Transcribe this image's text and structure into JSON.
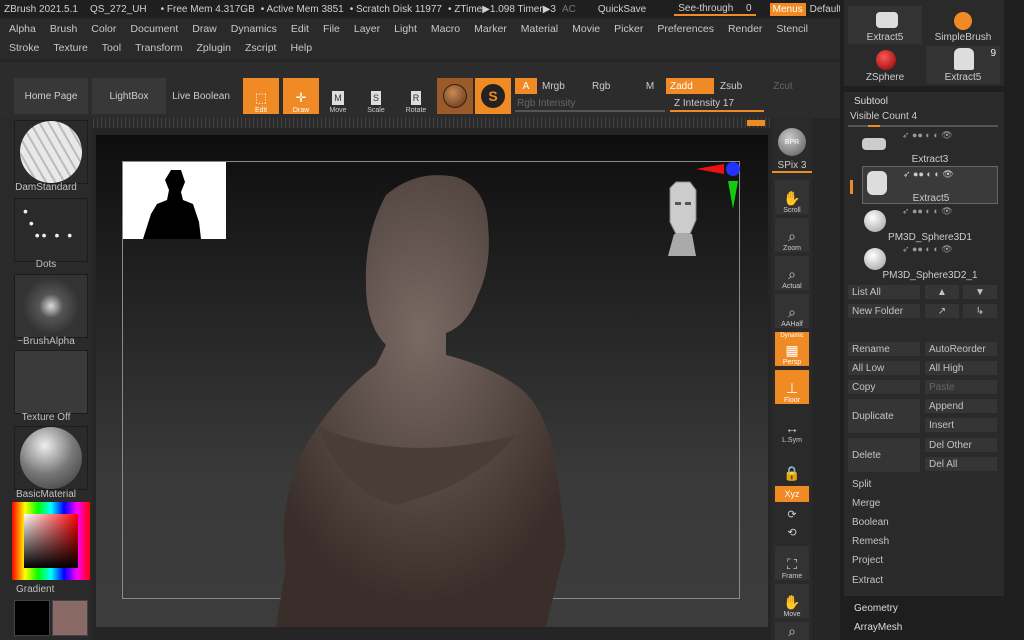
{
  "titlebar": {
    "app": "ZBrush 2021.5.1",
    "file": "QS_272_UH",
    "free_mem": "• Free Mem 4.317GB",
    "active_mem": "• Active Mem 3851",
    "scratch": "• Scratch Disk 11977",
    "ztime": "• ZTime▶1.098 Timer▶3",
    "ac": "AC",
    "quicksave": "QuickSave",
    "seethrough": "See-through",
    "seethrough_val": "0",
    "menus": "Menus",
    "zscript": "DefaultZScript"
  },
  "menu_row1": [
    "Alpha",
    "Brush",
    "Color",
    "Document",
    "Draw",
    "Dynamics",
    "Edit",
    "File",
    "Layer",
    "Light",
    "Macro",
    "Marker",
    "Material",
    "Movie",
    "Picker",
    "Preferences",
    "Render",
    "Stencil"
  ],
  "menu_row2": [
    "Stroke",
    "Texture",
    "Tool",
    "Transform",
    "Zplugin",
    "Zscript",
    "Help"
  ],
  "shelf": {
    "home": "Home Page",
    "lightbox": "LightBox",
    "liveboolean": "Live Boolean",
    "edit": "Edit",
    "draw": "Draw",
    "move": "Move",
    "scale": "Scale",
    "rotate": "Rotate",
    "a": "A",
    "mrgb": "Mrgb",
    "rgb": "Rgb",
    "m": "M",
    "zadd": "Zadd",
    "zsub": "Zsub",
    "zcut": "Zcut",
    "rgb_intensity": "Rgb Intensity",
    "z_intensity": "Z Intensity",
    "z_intensity_val": "17"
  },
  "left": {
    "brush": "DamStandard",
    "stroke": "Dots",
    "alpha": "~BrushAlpha",
    "texture": "Texture Off",
    "material": "BasicMaterial",
    "gradient": "Gradient"
  },
  "rightbar": {
    "bpr": "BPR",
    "spix": "SPix",
    "spix_val": "3",
    "scroll": "Scroll",
    "zoom": "Zoom",
    "actual": "Actual",
    "aahalf": "AAHalf",
    "dynamic": "Dynamic",
    "persp": "Persp",
    "floor": "Floor",
    "lsym": "L.Sym",
    "xyz": "Xyz",
    "frame": "Frame",
    "move": "Move"
  },
  "tools": {
    "extract5a": "Extract5",
    "simplebrush": "SimpleBrush",
    "zsphere": "ZSphere",
    "extract5b": "Extract5",
    "count": "9"
  },
  "subtool": {
    "title": "Subtool",
    "visible_count": "Visible Count",
    "visible_count_val": "4",
    "items": [
      "Extract3",
      "Extract5",
      "PM3D_Sphere3D1",
      "PM3D_Sphere3D2_1"
    ],
    "list_all": "List All",
    "new_folder": "New Folder",
    "rename": "Rename",
    "autoreorder": "AutoReorder",
    "all_low": "All Low",
    "all_high": "All High",
    "copy": "Copy",
    "paste": "Paste",
    "duplicate": "Duplicate",
    "append": "Append",
    "insert": "Insert",
    "delete": "Delete",
    "del_other": "Del Other",
    "del_all": "Del All",
    "split": "Split",
    "merge": "Merge",
    "boolean": "Boolean",
    "remesh": "Remesh",
    "project": "Project",
    "extract": "Extract",
    "geometry": "Geometry",
    "arraymesh": "ArrayMesh"
  },
  "colors": {
    "accent": "#f08a24",
    "panel": "#2e2e2e",
    "bg": "#262626"
  }
}
